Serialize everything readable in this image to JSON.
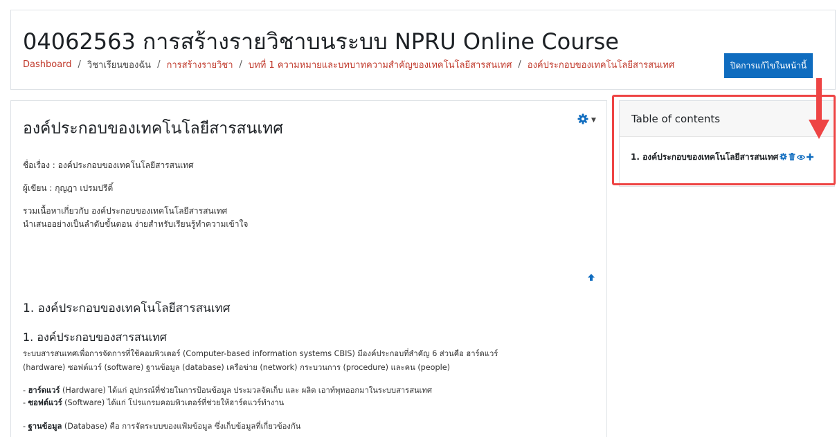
{
  "header": {
    "course_title": "04062563 การสร้างรายวิชาบนระบบ NPRU Online Course",
    "breadcrumb": [
      {
        "label": "Dashboard",
        "link": true
      },
      {
        "label": "วิชาเรียนของฉัน",
        "link": false
      },
      {
        "label": "การสร้างรายวิชา",
        "link": true
      },
      {
        "label": "บทที่ 1 ความหมายและบทบาทความสำคัญของเทคโนโลยีสารสนเทศ",
        "link": true
      },
      {
        "label": "องค์ประกอบของเทคโนโลยีสารสนเทศ",
        "link": true
      }
    ],
    "breadcrumb_separator": "/",
    "edit_button_label": "ปิดการแก้ไขในหน้านี้"
  },
  "main": {
    "page_title": "องค์ประกอบของเทคโนโลยีสารสนเทศ",
    "gear_icon": "gear-icon",
    "topic_line": "ชื่อเรื่อง : องค์ประกอบของเทคโนโลยีสารสนเทศ",
    "author_line": "ผู้เขียน : กุญฎา เปรมปรีดิ์",
    "summary_line_1": "รวมเนื้อหาเกี่ยวกับ องค์ประกอบของเทคโนโลยีสารสนเทศ",
    "summary_line_2": "นำเสนออย่างเป็นลำดับขั้นตอน   ง่ายสำหรับเรียนรู้ทำความเข้าใจ",
    "section_heading": "1. องค์ประกอบของเทคโนโลยีสารสนเทศ",
    "subsection_heading": "1. องค์ประกอบของสารสนเทศ",
    "intro_line_1": "ระบบสารสนเทศเพื่อการจัดการที่ใช้คอมพิวเตอร์ (Computer-based information systems CBIS) มีองค์ประกอบที่สำคัญ 6 ส่วนคือ ฮาร์ดแวร์",
    "intro_line_2": "(hardware) ซอฟต์แวร์ (software) ฐานข้อมูล (database) เครือข่าย (network) กระบวนการ (procedure) และคน (people)",
    "items": [
      {
        "term": "ฮาร์ดแวร์",
        "desc": " (Hardware) ได้แก่ อุปกรณ์ที่ช่วยในการป้อนข้อมูล ประมวลจัดเก็บ และ ผลิต เอาท์พุทออกมาในระบบสารสนเทศ"
      },
      {
        "term": "ซอฟต์แวร์",
        "desc": " (Software) ได้แก่ โปรแกรมคอมพิวเตอร์ที่ช่วยให้ฮาร์ดแวร์ทำงาน"
      },
      {
        "term": "ฐานข้อมูล",
        "desc": " (Database) คือ การจัดระบบของแฟ้มข้อมูล ซึ่งเก็บข้อมูลที่เกี่ยวข้องกัน"
      }
    ],
    "item_prefix": "- "
  },
  "toc": {
    "title": "Table of contents",
    "item_label": "1. องค์ประกอบของเทคโนโลยีสารสนเทศ",
    "item_icons": [
      "gear-icon",
      "trash-icon",
      "eye-icon",
      "plus-icon"
    ]
  },
  "colors": {
    "link": "#c0392b",
    "button": "#0f6cbf",
    "icon_blue": "#0f6cbf",
    "annotation_red": "#ee4444"
  }
}
